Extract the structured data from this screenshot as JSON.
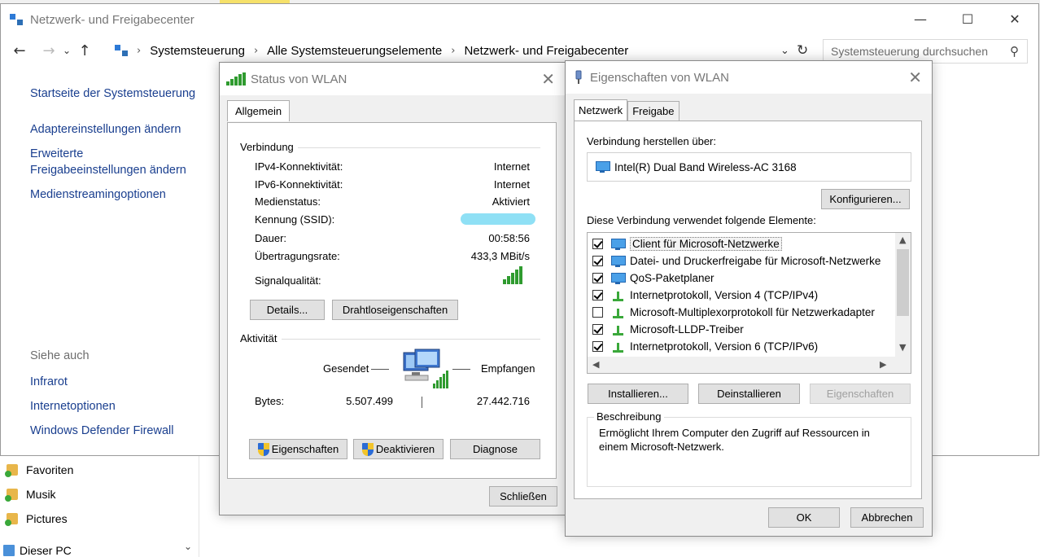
{
  "main_window": {
    "title": "Netzwerk- und Freigabecenter",
    "controls": {
      "minimize": "—",
      "maximize": "☐",
      "close": "✕"
    },
    "breadcrumb": [
      "Systemsteuerung",
      "Alle Systemsteuerungselemente",
      "Netzwerk- und Freigabecenter"
    ],
    "search_placeholder": "Systemsteuerung durchsuchen",
    "nav_links": {
      "home": "Startseite der Systemsteuerung",
      "adapter": "Adaptereinstellungen ändern",
      "sharing_1": "Erweiterte",
      "sharing_2": "Freigabeeinstellungen ändern",
      "streaming": "Medienstreamingoptionen"
    },
    "see_also": {
      "label": "Siehe auch",
      "infrared": "Infrarot",
      "internet_options": "Internetoptionen",
      "firewall": "Windows Defender Firewall"
    }
  },
  "explorer_bg": {
    "items": [
      "Favoriten",
      "Musik",
      "Pictures",
      "Dieser PC"
    ]
  },
  "status_dialog": {
    "title": "Status von WLAN",
    "tab": "Allgemein",
    "connection_group": "Verbindung",
    "rows": {
      "ipv4_label": "IPv4-Konnektivität:",
      "ipv4_value": "Internet",
      "ipv6_label": "IPv6-Konnektivität:",
      "ipv6_value": "Internet",
      "media_label": "Medienstatus:",
      "media_value": "Aktiviert",
      "ssid_label": "Kennung (SSID):",
      "duration_label": "Dauer:",
      "duration_value": "00:58:56",
      "rate_label": "Übertragungsrate:",
      "rate_value": "433,3 MBit/s",
      "signal_label": "Signalqualität:"
    },
    "signal_bars": 5,
    "details_button": "Details...",
    "wireless_button": "Drahtloseigenschaften",
    "activity_group": "Aktivität",
    "sent_label": "Gesendet",
    "received_label": "Empfangen",
    "bytes_label": "Bytes:",
    "bytes_sent": "5.507.499",
    "bytes_received": "27.442.716",
    "properties_button": "Eigenschaften",
    "disable_button": "Deaktivieren",
    "diagnose_button": "Diagnose",
    "close_button": "Schließen"
  },
  "props_dialog": {
    "title": "Eigenschaften von WLAN",
    "tabs": [
      "Netzwerk",
      "Freigabe"
    ],
    "connect_using_label": "Verbindung herstellen über:",
    "adapter": "Intel(R) Dual Band Wireless-AC 3168",
    "configure_button": "Konfigurieren...",
    "items_label": "Diese Verbindung verwendet folgende Elemente:",
    "items": [
      {
        "label": "Client für Microsoft-Netzwerke",
        "checked": true,
        "icon": "client-icon"
      },
      {
        "label": "Datei- und Druckerfreigabe für Microsoft-Netzwerke",
        "checked": true,
        "icon": "client-icon"
      },
      {
        "label": "QoS-Paketplaner",
        "checked": true,
        "icon": "client-icon"
      },
      {
        "label": "Internetprotokoll, Version 4 (TCP/IPv4)",
        "checked": true,
        "icon": "protocol-icon"
      },
      {
        "label": "Microsoft-Multiplexorprotokoll für Netzwerkadapter",
        "checked": false,
        "icon": "protocol-icon"
      },
      {
        "label": "Microsoft-LLDP-Treiber",
        "checked": true,
        "icon": "protocol-icon"
      },
      {
        "label": "Internetprotokoll, Version 6 (TCP/IPv6)",
        "checked": true,
        "icon": "protocol-icon"
      }
    ],
    "install_button": "Installieren...",
    "uninstall_button": "Deinstallieren",
    "properties_button": "Eigenschaften",
    "description_label": "Beschreibung",
    "description_text_1": "Ermöglicht Ihrem Computer den Zugriff auf Ressourcen in",
    "description_text_2": "einem Microsoft-Netzwerk.",
    "ok_button": "OK",
    "cancel_button": "Abbrechen"
  },
  "colors": {
    "link": "#1a3f8f",
    "signal": "#2f9b2f",
    "accent": "#0078d7"
  }
}
